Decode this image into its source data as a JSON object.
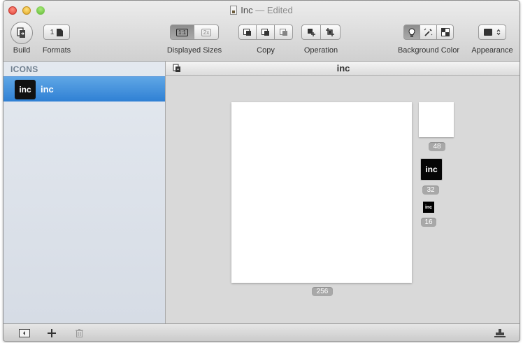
{
  "window": {
    "title": "Inc",
    "title_status": "— Edited"
  },
  "toolbar": {
    "build_label": "Build",
    "formats_label": "Formats",
    "formats_count": "1",
    "displayed_sizes_label": "Displayed Sizes",
    "displayed_sizes_1x": "1:1",
    "displayed_sizes_2x": "2x",
    "copy_label": "Copy",
    "operation_label": "Operation",
    "background_color_label": "Background Color",
    "appearance_label": "Appearance"
  },
  "sidebar": {
    "header": "ICONS",
    "items": [
      {
        "thumb_text": "inc",
        "label": "inc"
      }
    ]
  },
  "main": {
    "header_title": "inc",
    "previews": [
      {
        "size": "256",
        "content": ""
      },
      {
        "size": "48",
        "content": ""
      },
      {
        "size": "32",
        "content": "inc"
      },
      {
        "size": "16",
        "content": "inc"
      }
    ]
  },
  "colors": {
    "selection": "#3a8ad8",
    "canvas": "#d9d9d9",
    "sidebar": "#dde3eb"
  }
}
